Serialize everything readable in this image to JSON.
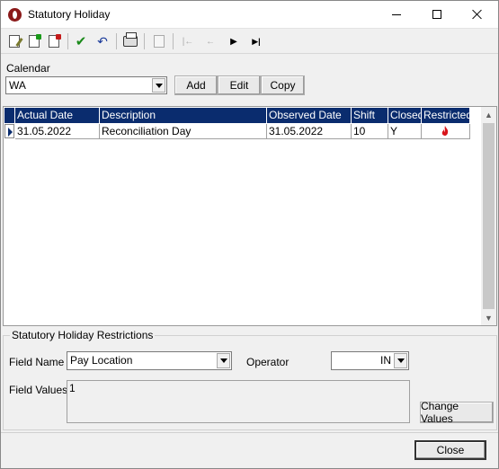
{
  "window": {
    "title": "Statutory Holiday"
  },
  "toolbar": {
    "buttons": [
      {
        "icon": "edit-document-icon"
      },
      {
        "icon": "new-document-icon"
      },
      {
        "icon": "delete-document-icon"
      },
      {
        "icon": "check-icon"
      },
      {
        "icon": "undo-icon"
      },
      {
        "icon": "print-icon"
      },
      {
        "icon": "refresh-icon"
      },
      {
        "icon": "first-record-icon"
      },
      {
        "icon": "previous-record-icon"
      },
      {
        "icon": "next-record-icon"
      },
      {
        "icon": "last-record-icon"
      }
    ],
    "glyphs": {
      "check": "✔",
      "undo": "↶",
      "first": "|←",
      "prev": "←",
      "next": "▶",
      "last": "▶|"
    }
  },
  "calendar": {
    "label": "Calendar",
    "value": "WA",
    "add_label": "Add",
    "edit_label": "Edit",
    "copy_label": "Copy"
  },
  "grid": {
    "columns": [
      "Actual Date",
      "Description",
      "Observed Date",
      "Shift",
      "Closed",
      "Restricted"
    ],
    "rows": [
      {
        "actual_date": "31.05.2022",
        "description": "Reconciliation Day",
        "observed_date": "31.05.2022",
        "shift": "10",
        "closed": "Y",
        "restricted_icon": "flame-icon"
      }
    ]
  },
  "restrictions": {
    "group_title": "Statutory Holiday Restrictions",
    "field_name_label": "Field Name",
    "field_name_value": "Pay Location",
    "operator_label": "Operator",
    "operator_value": "IN",
    "field_values_label": "Field Values",
    "field_values_value": "1",
    "change_values_label": "Change Values"
  },
  "footer": {
    "close_label": "Close"
  },
  "colors": {
    "header_bg": "#0a2c6e",
    "flame": "#d8141a"
  }
}
